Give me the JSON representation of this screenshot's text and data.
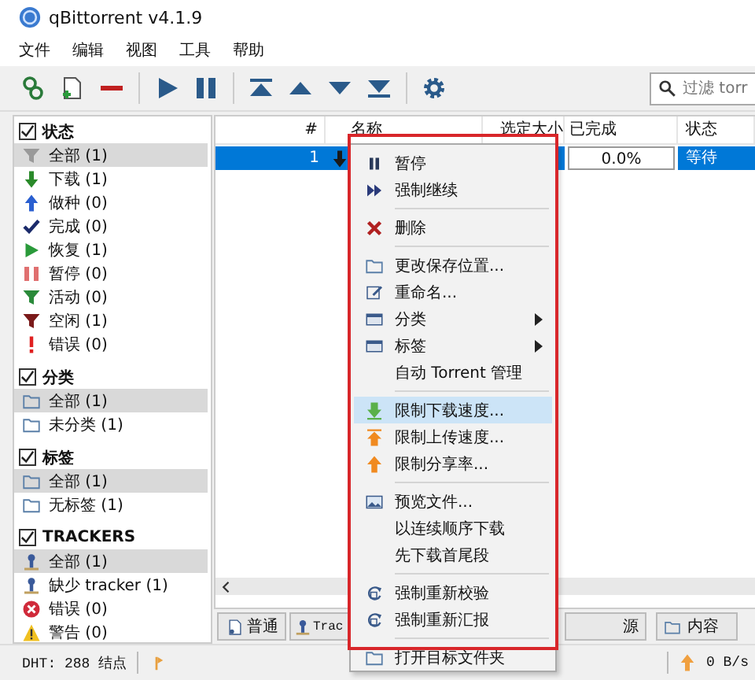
{
  "window": {
    "title": "qBittorrent v4.1.9"
  },
  "menu_bar": [
    "文件",
    "编辑",
    "视图",
    "工具",
    "帮助"
  ],
  "toolbar": {
    "search": {
      "placeholder": "过滤 torr"
    }
  },
  "sidebar": {
    "sections": [
      {
        "title": "状态",
        "checked": true,
        "items": [
          {
            "label": "全部 (1)",
            "selected": true
          },
          {
            "label": "下载 (1)",
            "selected": false
          },
          {
            "label": "做种 (0)",
            "selected": false
          },
          {
            "label": "完成 (0)",
            "selected": false
          },
          {
            "label": "恢复 (1)",
            "selected": false
          },
          {
            "label": "暂停 (0)",
            "selected": false
          },
          {
            "label": "活动 (0)",
            "selected": false
          },
          {
            "label": "空闲 (1)",
            "selected": false
          },
          {
            "label": "错误 (0)",
            "selected": false
          }
        ]
      },
      {
        "title": "分类",
        "checked": true,
        "items": [
          {
            "label": "全部 (1)",
            "selected": true
          },
          {
            "label": "未分类 (1)",
            "selected": false
          }
        ]
      },
      {
        "title": "标签",
        "checked": true,
        "items": [
          {
            "label": "全部 (1)",
            "selected": true
          },
          {
            "label": "无标签 (1)",
            "selected": false
          }
        ]
      },
      {
        "title": "TRACKERS",
        "checked": true,
        "items": [
          {
            "label": "全部 (1)",
            "selected": true
          },
          {
            "label": "缺少 tracker (1)",
            "selected": false
          },
          {
            "label": "错误 (0)",
            "selected": false
          },
          {
            "label": "警告 (0)",
            "selected": false
          }
        ]
      }
    ]
  },
  "torrent_list": {
    "columns": [
      "#",
      "名称",
      "选定大小",
      "已完成",
      "状态"
    ],
    "rows": [
      {
        "number": "1",
        "selected": true,
        "progress": "0.0%",
        "level": 0,
        "status": "等待"
      }
    ]
  },
  "detail_tabs": [
    {
      "label": "普通"
    },
    {
      "label": "Trac"
    },
    {
      "label": "源"
    },
    {
      "label": "内容"
    }
  ],
  "status_bar": {
    "dht": "DHT: 288 结点",
    "upload_speed": "0 B/s"
  },
  "context_menu": {
    "items": [
      {
        "kind": "item",
        "label": "暂停",
        "highlighted": false
      },
      {
        "kind": "item",
        "label": "强制继续",
        "highlighted": false
      },
      {
        "kind": "separator"
      },
      {
        "kind": "item",
        "label": "删除",
        "highlighted": false
      },
      {
        "kind": "separator"
      },
      {
        "kind": "item",
        "label": "更改保存位置...",
        "highlighted": false
      },
      {
        "kind": "item",
        "label": "重命名...",
        "highlighted": false
      },
      {
        "kind": "item",
        "label": "分类",
        "highlighted": false,
        "submenu": true
      },
      {
        "kind": "item",
        "label": "标签",
        "highlighted": false,
        "submenu": true
      },
      {
        "kind": "item",
        "label": "自动 Torrent 管理",
        "highlighted": false
      },
      {
        "kind": "separator"
      },
      {
        "kind": "item",
        "label": "限制下载速度...",
        "highlighted": true
      },
      {
        "kind": "item",
        "label": "限制上传速度...",
        "highlighted": false
      },
      {
        "kind": "item",
        "label": "限制分享率...",
        "highlighted": false
      },
      {
        "kind": "separator"
      },
      {
        "kind": "item",
        "label": "预览文件...",
        "highlighted": false
      },
      {
        "kind": "item",
        "label": "以连续顺序下载",
        "highlighted": false
      },
      {
        "kind": "item",
        "label": "先下载首尾段",
        "highlighted": false
      },
      {
        "kind": "separator"
      },
      {
        "kind": "item",
        "label": "强制重新校验",
        "highlighted": false
      },
      {
        "kind": "item",
        "label": "强制重新汇报",
        "highlighted": false
      },
      {
        "kind": "separator"
      },
      {
        "kind": "item",
        "label": "打开目标文件夹",
        "highlighted": false
      }
    ]
  }
}
